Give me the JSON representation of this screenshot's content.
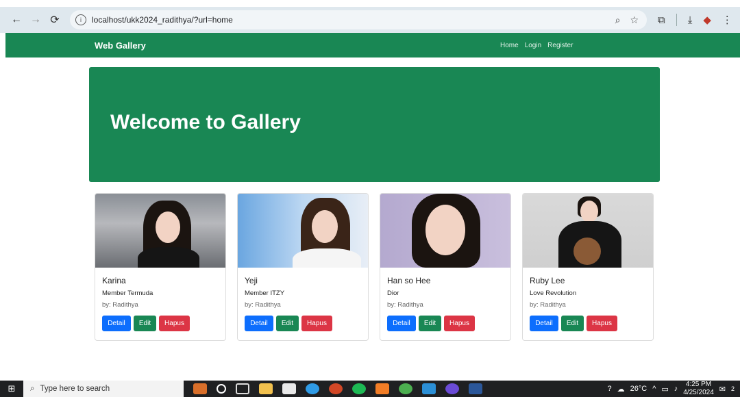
{
  "browser": {
    "url": "localhost/ukk2024_radithya/?url=home"
  },
  "site": {
    "brand": "Web Gallery",
    "nav": [
      "Home",
      "Login",
      "Register"
    ],
    "hero_title": "Welcome to Gallery"
  },
  "cards": [
    {
      "title": "Karina",
      "subtitle": "Member Termuda",
      "by": "by: Radithya",
      "detail": "Detail",
      "edit": "Edit",
      "hapus": "Hapus"
    },
    {
      "title": "Yeji",
      "subtitle": "Member ITZY",
      "by": "by: Radithya",
      "detail": "Detail",
      "edit": "Edit",
      "hapus": "Hapus"
    },
    {
      "title": "Han so Hee",
      "subtitle": "Dior",
      "by": "by: Radithya",
      "detail": "Detail",
      "edit": "Edit",
      "hapus": "Hapus"
    },
    {
      "title": "Ruby Lee",
      "subtitle": "Love Revolution",
      "by": "by: Radithya",
      "detail": "Detail",
      "edit": "Edit",
      "hapus": "Hapus"
    }
  ],
  "taskbar": {
    "search_placeholder": "Type here to search",
    "temperature": "26°C",
    "time": "4:25 PM",
    "date": "4/25/2024",
    "notification_count": "2"
  },
  "colors": {
    "primary_green": "#198754",
    "detail_blue": "#0d6efd",
    "hapus_red": "#dc3545"
  }
}
